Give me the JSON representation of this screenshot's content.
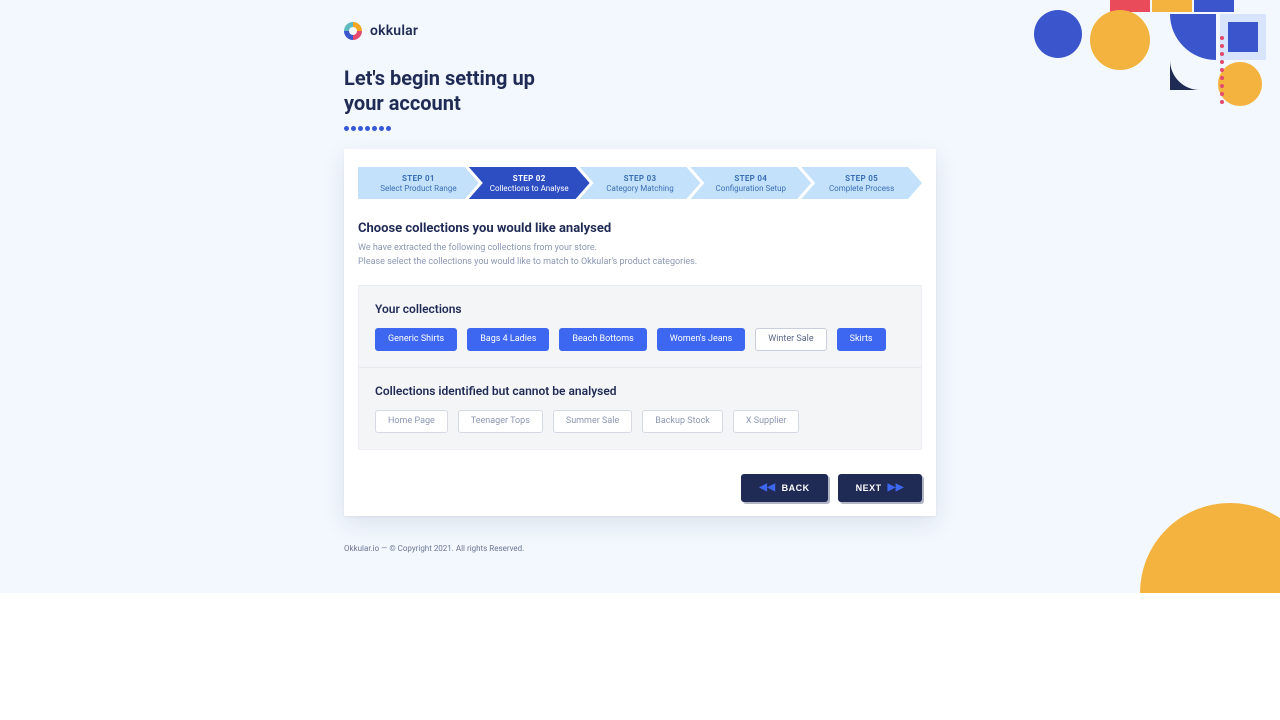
{
  "brand": {
    "name": "okkular"
  },
  "heading": "Let's begin setting up your account",
  "stepper": [
    {
      "no": "STEP 01",
      "label": "Select Product Range"
    },
    {
      "no": "STEP 02",
      "label": "Collections to Analyse"
    },
    {
      "no": "STEP 03",
      "label": "Category Matching"
    },
    {
      "no": "STEP 04",
      "label": "Configuration Setup"
    },
    {
      "no": "STEP 05",
      "label": "Complete Process"
    }
  ],
  "active_step_index": 1,
  "section": {
    "title": "Choose collections you would like analysed",
    "sub1": "We have extracted the following collections from your store.",
    "sub2": "Please select the collections you would like to match to Okkular's product categories."
  },
  "your_collections": {
    "title": "Your collections",
    "items": [
      {
        "label": "Generic Shirts",
        "selected": true
      },
      {
        "label": "Bags 4 Ladies",
        "selected": true
      },
      {
        "label": "Beach Bottoms",
        "selected": true
      },
      {
        "label": "Women's Jeans",
        "selected": true
      },
      {
        "label": "Winter Sale",
        "selected": false
      },
      {
        "label": "Skirts",
        "selected": true
      }
    ]
  },
  "blocked_collections": {
    "title": "Collections identified but cannot be analysed",
    "items": [
      {
        "label": "Home Page"
      },
      {
        "label": "Teenager Tops"
      },
      {
        "label": "Summer Sale"
      },
      {
        "label": "Backup Stock"
      },
      {
        "label": "X Supplier"
      }
    ]
  },
  "actions": {
    "back": "BACK",
    "next": "NEXT"
  },
  "footer": "Okkular.io — © Copyright 2021. All rights Reserved."
}
